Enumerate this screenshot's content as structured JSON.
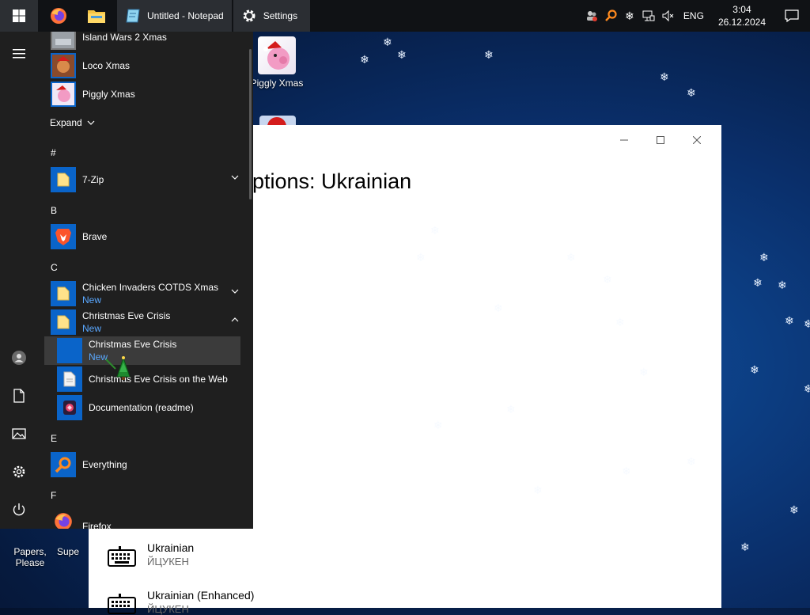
{
  "taskbar": {
    "apps": [
      {
        "label": "Untitled - Notepad",
        "icon": "notepad-icon"
      },
      {
        "label": "Settings",
        "icon": "gear-icon"
      }
    ],
    "language": "ENG",
    "time": "3:04",
    "date": "26.12.2024"
  },
  "desktop": {
    "icons": [
      {
        "label": "Piggly Xmas"
      },
      {
        "label": "Papers, Please"
      },
      {
        "label": "Supe"
      }
    ]
  },
  "window": {
    "title": "ptions: Ukrainian",
    "keyboards": [
      {
        "name": "Ukrainian",
        "layout": "ЙЦУКЕН"
      },
      {
        "name": "Ukrainian (Enhanced)",
        "layout": "ЙЦУКЕН"
      }
    ]
  },
  "start_menu": {
    "expand_label": "Expand",
    "sections": {
      "hash": "#",
      "b": "B",
      "c": "C",
      "e": "E",
      "f": "F"
    },
    "items": {
      "island_wars": "Island Wars 2 Xmas",
      "loco_xmas": "Loco Xmas",
      "piggly_xmas": "Piggly Xmas",
      "seven_zip": "7-Zip",
      "brave": "Brave",
      "chicken_invaders": "Chicken Invaders COTDS Xmas",
      "christmas_eve_folder": "Christmas Eve Crisis",
      "christmas_eve_app": "Christmas Eve Crisis",
      "christmas_eve_web": "Christmas Eve Crisis on the Web",
      "documentation": "Documentation (readme)",
      "everything": "Everything",
      "firefox": "Firefox"
    },
    "new_badge": "New"
  },
  "colors": {
    "accent": "#0a64c9",
    "new_badge": "#5aa8ff",
    "menu_bg": "#1f1f1f",
    "taskbar_bg": "#101215"
  }
}
